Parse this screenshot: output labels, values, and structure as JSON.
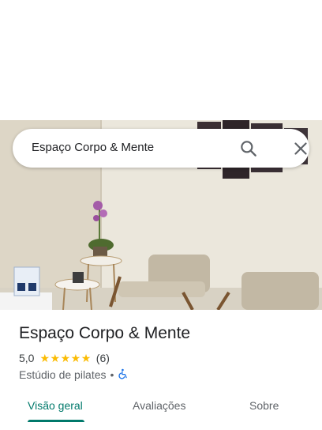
{
  "search": {
    "query": "Espaço Corpo & Mente",
    "search_icon": "search-icon",
    "close_icon": "close-icon"
  },
  "place": {
    "name": "Espaço Corpo & Mente",
    "rating": "5,0",
    "stars": 5,
    "review_count": "(6)",
    "category": "Estúdio de pilates",
    "separator": "•",
    "accessibility_icon": "wheelchair-icon"
  },
  "tabs": [
    {
      "label": "Visão geral",
      "active": true
    },
    {
      "label": "Avaliações",
      "active": false
    },
    {
      "label": "Sobre",
      "active": false
    }
  ],
  "colors": {
    "accent": "#00796b",
    "star": "#fbbc04",
    "accessibility": "#1a73e8"
  }
}
